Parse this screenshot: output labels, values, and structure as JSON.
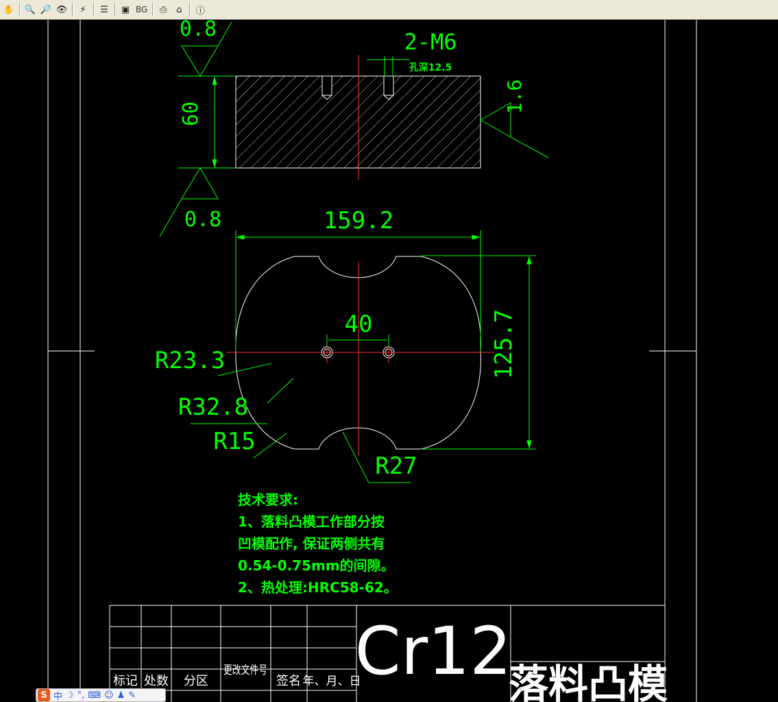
{
  "toolbar": {
    "bg_label": "BG"
  },
  "drawing": {
    "side_view": {
      "roughness_top": "0.8",
      "roughness_bottom": "0.8",
      "roughness_right": "1.6",
      "height_dim": "60",
      "hole_label": "2-M6",
      "hole_depth": "孔深12.5"
    },
    "top_view": {
      "width_dim": "159.2",
      "height_dim": "125.7",
      "hole_spacing": "40",
      "r1": "R23.3",
      "r2": "R32.8",
      "r3": "R15",
      "r4": "R27"
    },
    "notes": [
      "技术要求:",
      "1、落料凸模工作部分按",
      "凹模配作, 保证两侧共有",
      "0.54-0.75mm的间隙。",
      "2、热处理:HRC58-62。"
    ]
  },
  "title_block": {
    "headers": [
      "标记",
      "处数",
      "分区",
      "更改文件号",
      "签名",
      "年、月、日"
    ],
    "material": "Cr12",
    "part_name": "落料凸模"
  },
  "ime": {
    "lang": "中"
  },
  "colors": {
    "background": "#000000",
    "dimension": "#00ff00",
    "geometry": "#ffffff",
    "centerline": "#ff0000"
  }
}
